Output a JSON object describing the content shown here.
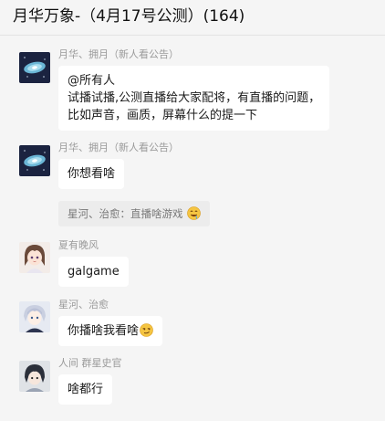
{
  "window": {
    "title": "月华万象-（4月17号公测）(164)"
  },
  "messages": [
    {
      "sender": "月华、拥月（新人看公告）",
      "lines": [
        "@所有人",
        "试播试播,公测直播给大家配将，有直播的问题，",
        "比如声音，画质，屏幕什么的提一下"
      ],
      "avatar_icon": "galaxy-avatar-icon"
    },
    {
      "sender": "月华、拥月（新人看公告）",
      "lines": [
        "你想看啥"
      ],
      "avatar_icon": "galaxy-avatar-icon",
      "quote": {
        "text": "星河、治愈：直播啥游戏",
        "emoji": "drooling-face-emoji"
      }
    },
    {
      "sender": "夏有晚风",
      "lines": [
        "galgame"
      ],
      "avatar_icon": "anime-girl-avatar-icon"
    },
    {
      "sender": "星河、治愈",
      "lines": [
        "你播啥我看啥"
      ],
      "avatar_icon": "anime-boy-avatar-icon",
      "emoji": "smirk-face-emoji"
    },
    {
      "sender": "人间 群星史官",
      "lines": [
        "啥都行"
      ],
      "avatar_icon": "dark-hair-avatar-icon"
    }
  ],
  "colors": {
    "background": "#f5f5f5",
    "bubble": "#ffffff",
    "sender_text": "#9a9a9a",
    "quote_bg": "#ececec"
  }
}
